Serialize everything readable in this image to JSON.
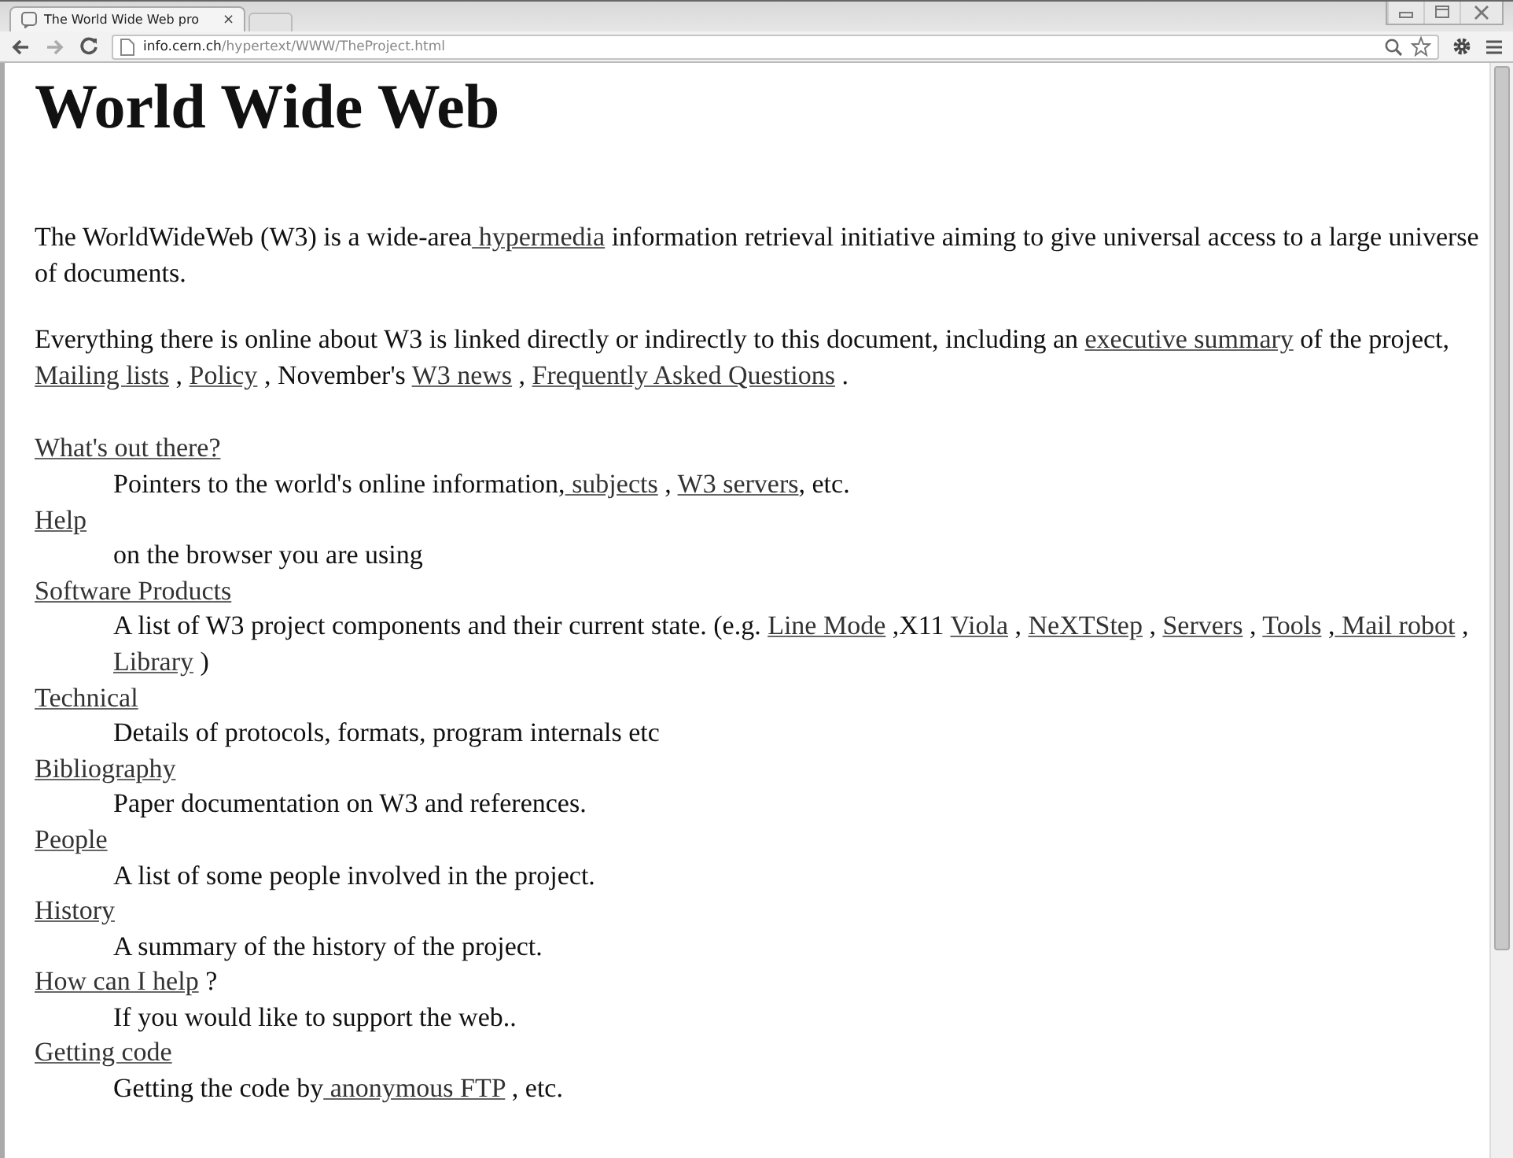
{
  "browser": {
    "tab": {
      "title": "The World Wide Web pro",
      "close": "×"
    },
    "address": {
      "host": "info.cern.ch",
      "path": "/hypertext/WWW/TheProject.html"
    }
  },
  "page": {
    "heading": "World Wide Web",
    "paragraphs": [
      [
        {
          "text": "The WorldWideWeb (W3) is a wide-area",
          "link": false
        },
        {
          "text": " hypermedia",
          "link": true
        },
        {
          "text": " information retrieval initiative aiming to give universal access to a large universe of documents.",
          "link": false
        }
      ],
      [
        {
          "text": "Everything there is online about W3 is linked directly or indirectly to this document, including an ",
          "link": false
        },
        {
          "text": "executive summary",
          "link": true
        },
        {
          "text": " of the project, ",
          "link": false
        },
        {
          "text": "Mailing lists",
          "link": true
        },
        {
          "text": " , ",
          "link": false
        },
        {
          "text": "Policy",
          "link": true
        },
        {
          "text": " , November's ",
          "link": false
        },
        {
          "text": "W3 news",
          "link": true
        },
        {
          "text": " , ",
          "link": false
        },
        {
          "text": "Frequently Asked Questions",
          "link": true
        },
        {
          "text": " .",
          "link": false
        }
      ]
    ],
    "topics": [
      {
        "term": [
          {
            "text": "What's out there?",
            "link": true
          }
        ],
        "description": [
          {
            "text": "Pointers to the world's online information,",
            "link": false
          },
          {
            "text": " subjects",
            "link": true
          },
          {
            "text": " , ",
            "link": false
          },
          {
            "text": "W3 servers",
            "link": true
          },
          {
            "text": ", etc.",
            "link": false
          }
        ]
      },
      {
        "term": [
          {
            "text": "Help",
            "link": true
          }
        ],
        "description": [
          {
            "text": "on the browser you are using",
            "link": false
          }
        ]
      },
      {
        "term": [
          {
            "text": "Software Products",
            "link": true
          }
        ],
        "description": [
          {
            "text": "A list of W3 project components and their current state. (e.g. ",
            "link": false
          },
          {
            "text": "Line Mode",
            "link": true
          },
          {
            "text": " ,X11 ",
            "link": false
          },
          {
            "text": "Viola",
            "link": true
          },
          {
            "text": " , ",
            "link": false
          },
          {
            "text": "NeXTStep",
            "link": true
          },
          {
            "text": " , ",
            "link": false
          },
          {
            "text": "Servers",
            "link": true
          },
          {
            "text": " , ",
            "link": false
          },
          {
            "text": "Tools",
            "link": true
          },
          {
            "text": " ,",
            "link": false
          },
          {
            "text": " Mail robot",
            "link": true
          },
          {
            "text": " ,",
            "link": false
          },
          {
            "text": " Library",
            "link": true
          },
          {
            "text": " )",
            "link": false
          }
        ]
      },
      {
        "term": [
          {
            "text": "Technical",
            "link": true
          }
        ],
        "description": [
          {
            "text": "Details of protocols, formats, program internals etc",
            "link": false
          }
        ]
      },
      {
        "term": [
          {
            "text": "Bibliography",
            "link": true
          }
        ],
        "description": [
          {
            "text": "Paper documentation on W3 and references.",
            "link": false
          }
        ]
      },
      {
        "term": [
          {
            "text": "People",
            "link": true
          }
        ],
        "description": [
          {
            "text": "A list of some people involved in the project.",
            "link": false
          }
        ]
      },
      {
        "term": [
          {
            "text": "History",
            "link": true
          }
        ],
        "description": [
          {
            "text": "A summary of the history of the project.",
            "link": false
          }
        ]
      },
      {
        "term": [
          {
            "text": "How can I help",
            "link": true
          },
          {
            "text": " ?",
            "link": false
          }
        ],
        "description": [
          {
            "text": "If you would like to support the web..",
            "link": false
          }
        ]
      },
      {
        "term": [
          {
            "text": "Getting code",
            "link": true
          }
        ],
        "description": [
          {
            "text": "Getting the code by",
            "link": false
          },
          {
            "text": " anonymous FTP",
            "link": true
          },
          {
            "text": " , etc.",
            "link": false
          }
        ]
      }
    ]
  }
}
